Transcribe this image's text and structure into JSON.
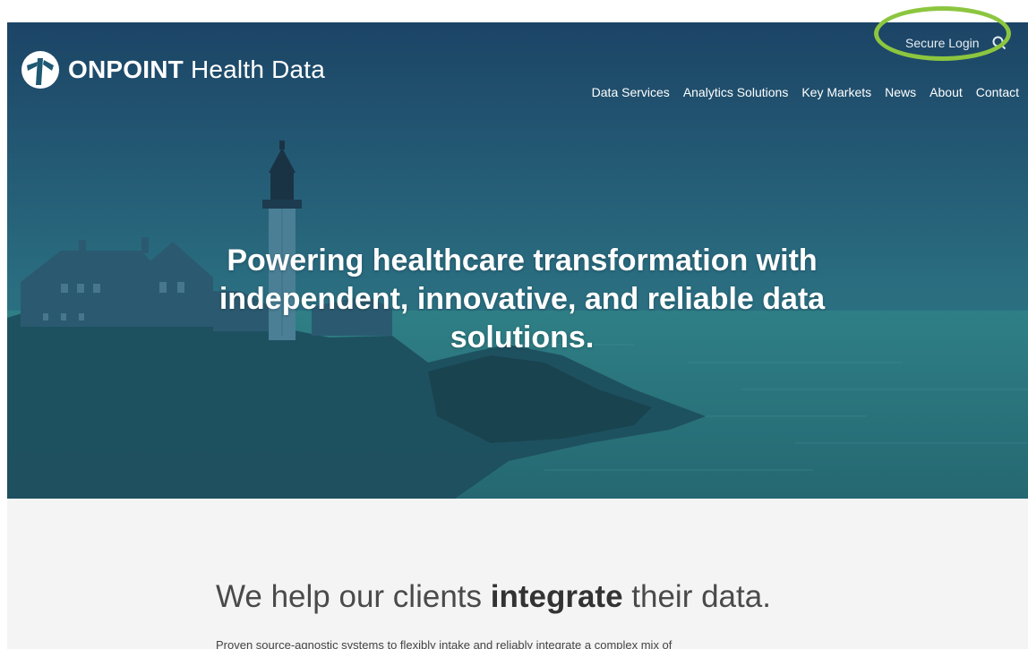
{
  "brand": {
    "name_bold": "ONPOINT",
    "name_rest": "Health Data",
    "logo_icon": "onpoint-logo-icon"
  },
  "utility": {
    "secure_login": "Secure Login",
    "search_icon": "search-icon"
  },
  "nav": {
    "items": [
      {
        "label": "Data Services"
      },
      {
        "label": "Analytics Solutions"
      },
      {
        "label": "Key Markets"
      },
      {
        "label": "News"
      },
      {
        "label": "About"
      },
      {
        "label": "Contact"
      }
    ]
  },
  "hero": {
    "headline_line1": "Powering healthcare transformation with",
    "headline_line2": "independent, innovative, and reliable data",
    "headline_line3": "solutions."
  },
  "intro": {
    "heading_pre": "We help our clients ",
    "heading_strong": "integrate",
    "heading_post": " their data.",
    "body": "Proven source-agnostic systems to flexibly intake and reliably integrate a complex mix of"
  },
  "colors": {
    "highlight_ring": "#8cc63f",
    "hero_overlay": "#1f5872",
    "intro_background": "#f4f4f4"
  }
}
